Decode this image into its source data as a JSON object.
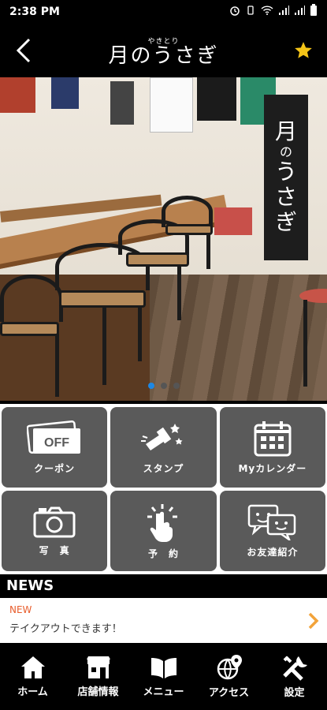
{
  "status": {
    "time": "2:38 PM"
  },
  "header": {
    "logo_small": "やきとり",
    "logo_main": "月のうさぎ"
  },
  "hero": {
    "sign_lines": [
      "月",
      "の",
      "う",
      "さ",
      "ぎ"
    ],
    "slide_count": 3,
    "active_slide": 0
  },
  "menu_tiles": [
    {
      "id": "coupon",
      "label": "クーポン",
      "icon": "coupon-icon",
      "badge": "OFF"
    },
    {
      "id": "stamp",
      "label": "スタンプ",
      "icon": "stamp-icon"
    },
    {
      "id": "calendar",
      "label": "Myカレンダー",
      "icon": "calendar-icon"
    },
    {
      "id": "photo",
      "label": "写　真",
      "icon": "camera-icon"
    },
    {
      "id": "reserve",
      "label": "予　約",
      "icon": "tap-icon"
    },
    {
      "id": "friend",
      "label": "お友達紹介",
      "icon": "chat-icon"
    }
  ],
  "news": {
    "title": "NEWS",
    "items": [
      {
        "tag": "NEW",
        "text": "テイクアウトできます！"
      }
    ]
  },
  "bottom_nav": [
    {
      "id": "home",
      "label": "ホーム",
      "icon": "home-icon"
    },
    {
      "id": "store",
      "label": "店舗情報",
      "icon": "store-icon"
    },
    {
      "id": "menu",
      "label": "メニュー",
      "icon": "book-icon"
    },
    {
      "id": "access",
      "label": "アクセス",
      "icon": "globe-pin-icon"
    },
    {
      "id": "settings",
      "label": "設定",
      "icon": "tools-icon"
    }
  ],
  "colors": {
    "accent_star": "#f5c518",
    "news_new": "#e85d2c",
    "tile_bg": "#5a5a5a",
    "dot_active": "#1e88e5"
  }
}
